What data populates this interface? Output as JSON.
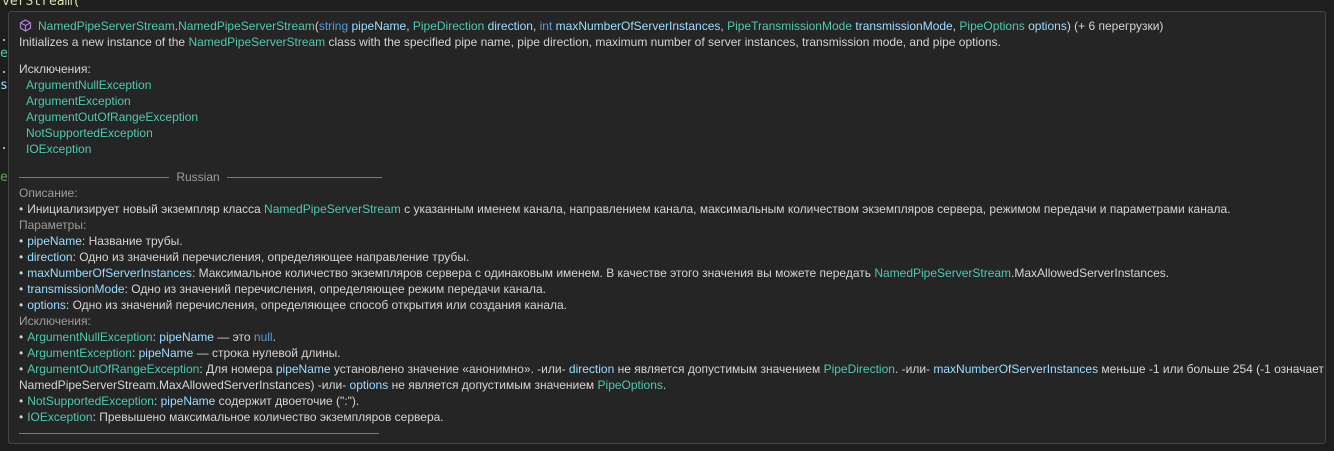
{
  "editor_background": {
    "top_code_fragment": "verStream(",
    "left_gutter_fragments": [
      ".",
      "e",
      ".",
      "s",
      ".",
      "e"
    ]
  },
  "signature": {
    "owner_class": "NamedPipeServerStream",
    "dot": ".",
    "method": "NamedPipeServerStream",
    "open_paren": "(",
    "params": [
      {
        "type": "string",
        "type_kind": "keyword",
        "name": "pipeName",
        "sep": ", "
      },
      {
        "type": "PipeDirection",
        "type_kind": "class",
        "name": "direction",
        "sep": ", "
      },
      {
        "type": "int",
        "type_kind": "keyword",
        "name": "maxNumberOfServerInstances",
        "sep": ", "
      },
      {
        "type": "PipeTransmissionMode",
        "type_kind": "class",
        "name": "transmissionMode",
        "sep": ", "
      },
      {
        "type": "PipeOptions",
        "type_kind": "class",
        "name": "options",
        "sep": ""
      }
    ],
    "close_paren": ")",
    "overloads": " (+ 6 перегрузки)"
  },
  "summary": {
    "prefix": "Initializes a new instance of the ",
    "class_ref": "NamedPipeServerStream",
    "suffix": " class with the specified pipe name, pipe direction, maximum number of server instances, transmission mode, and pipe options."
  },
  "exceptions_header": "Исключения:",
  "exceptions": [
    "ArgumentNullException",
    "ArgumentException",
    "ArgumentOutOfRangeException",
    "NotSupportedException",
    "IOException"
  ],
  "separator_label": "Russian",
  "russian": {
    "description_header": "Описание:",
    "description": {
      "prefix": "Инициализирует новый экземпляр класса ",
      "class_ref": "NamedPipeServerStream",
      "suffix": " с указанным именем канала, направлением канала, максимальным количеством экземпляров сервера, режимом передачи и параметрами канала."
    },
    "params_header": "Параметры:",
    "params": [
      {
        "name": "pipeName",
        "text": ": Название трубы."
      },
      {
        "name": "direction",
        "text": ": Одно из значений перечисления, определяющее направление трубы."
      },
      {
        "name": "maxNumberOfServerInstances",
        "text": ": Максимальное количество экземпляров сервера с одинаковым именем. В качестве этого значения вы можете передать ",
        "ref": "NamedPipeServerStream",
        "tail": ".MaxAllowedServerInstances."
      },
      {
        "name": "transmissionMode",
        "text": ": Одно из значений перечисления, определяющее режим передачи канала."
      },
      {
        "name": "options",
        "text": ": Одно из значений перечисления, определяющее способ открытия или создания канала."
      }
    ],
    "exceptions_header": "Исключения:",
    "exceptions": {
      "e1": {
        "name": "ArgumentNullException",
        "colon": ": ",
        "p": "pipeName",
        "mid": " — это ",
        "nullkw": "null",
        "end": "."
      },
      "e2": {
        "name": "ArgumentException",
        "colon": ": ",
        "p": "pipeName",
        "end": " — строка нулевой длины."
      },
      "e3": {
        "name": "ArgumentOutOfRangeException",
        "t1": ": Для номера ",
        "p1": "pipeName",
        "t2": " установлено значение «анонимно». -или- ",
        "p2": "direction",
        "t3": " не является допустимым значением ",
        "c1": "PipeDirection",
        "t4": ". -или- ",
        "p3": "maxNumberOfServerInstances",
        "t5": " меньше -1 или больше 254 (-1 означает",
        "l2": "NamedPipeServerStream.MaxAllowedServerInstances) -или- ",
        "p4": "options",
        "t6": " не является допустимым значением ",
        "c2": "PipeOptions",
        "t7": "."
      },
      "e4": {
        "name": "NotSupportedException",
        "colon": ": ",
        "p": "pipeName",
        "end": " содержит двоеточие (\":\")."
      },
      "e5": {
        "name": "IOException",
        "end": ": Превышено максимальное количество экземпляров сервера."
      }
    }
  }
}
